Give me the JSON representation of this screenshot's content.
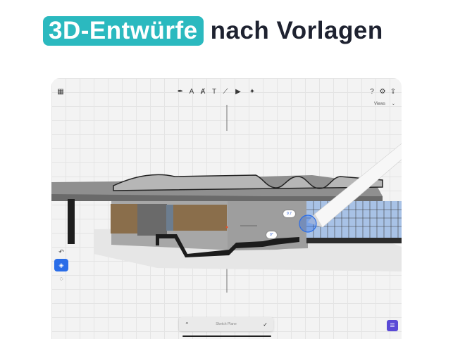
{
  "headline": {
    "highlight": "3D-Entwürfe",
    "rest": "nach Vorlagen"
  },
  "colors": {
    "badge": "#2bb9bf",
    "accent": "#2a6de8",
    "notes": "#5a4ad6"
  },
  "toolbar": {
    "left_icon": "grid-icon",
    "tools": [
      "pen-icon",
      "pencil-icon",
      "marker-icon",
      "text-icon",
      "ruler-icon",
      "video-icon",
      "sparkle-icon"
    ],
    "right_icons": [
      "help-icon",
      "settings-icon",
      "share-icon"
    ],
    "views_label": "Views"
  },
  "side_tools": [
    "undo-icon",
    "plane-icon",
    "lasso-icon"
  ],
  "dimensions": {
    "length": "9.7",
    "angle": "0°"
  },
  "sketch_bar": {
    "label": "Sketch Plane"
  }
}
